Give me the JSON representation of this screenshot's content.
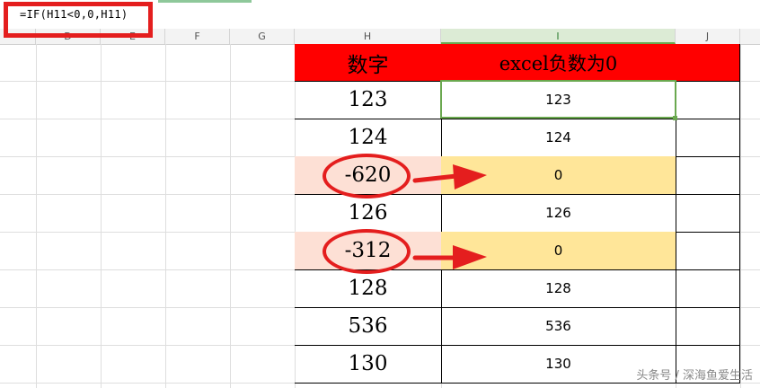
{
  "formula_bar": {
    "formula": "=IF(H11<0,0,H11)"
  },
  "columns": [
    "D",
    "E",
    "F",
    "G",
    "H",
    "I",
    "J"
  ],
  "table": {
    "header_h": "数字",
    "header_i": "excel负数为0",
    "rows": [
      {
        "h": "123",
        "i": "123"
      },
      {
        "h": "124",
        "i": "124"
      },
      {
        "h": "-620",
        "i": "0"
      },
      {
        "h": "126",
        "i": "126"
      },
      {
        "h": "-312",
        "i": "0"
      },
      {
        "h": "128",
        "i": "128"
      },
      {
        "h": "536",
        "i": "536"
      },
      {
        "h": "130",
        "i": "130"
      }
    ]
  },
  "colors": {
    "header_fill": "#ff0000",
    "negative_fill": "#fde0d5",
    "result_fill": "#ffe699",
    "annotation": "#e41e1e",
    "selection": "#6aa84f"
  },
  "watermark": "头条号 / 深海鱼爱生活"
}
